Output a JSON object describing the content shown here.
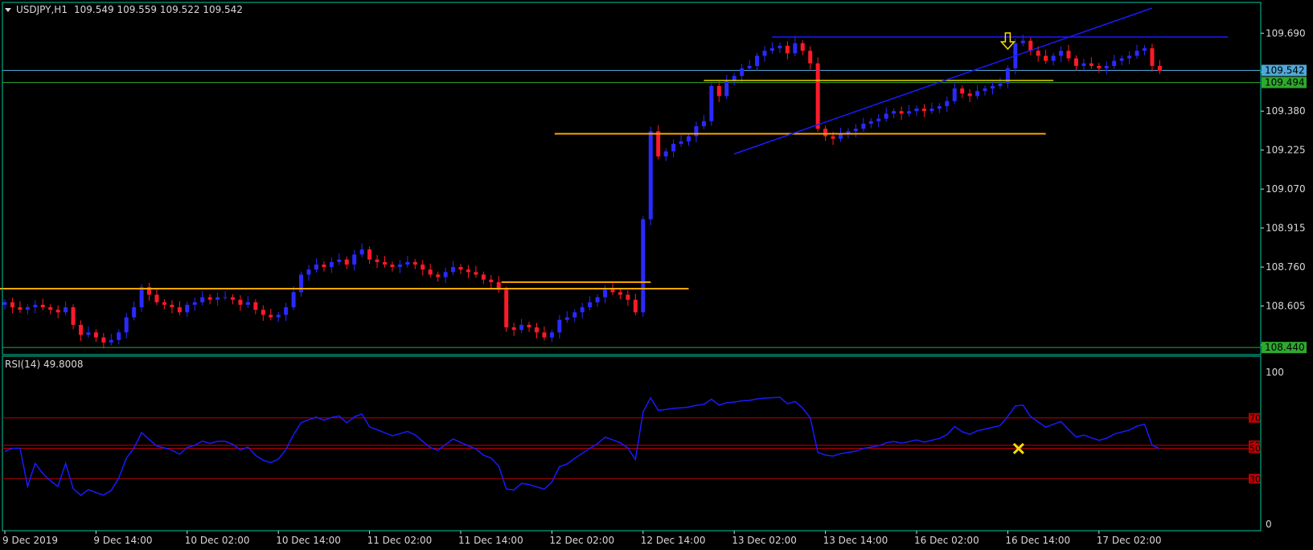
{
  "header": {
    "symbol": "USDJPY,H1",
    "ohlc": "109.549 109.559 109.522 109.542",
    "rsi_label": "RSI(14) 49.8008"
  },
  "colors": {
    "background": "#000000",
    "frame": "#00c8a0",
    "text": "#d8d8d8",
    "bull": "#2a2aff",
    "bear": "#ff1a2a",
    "level": "#ffa500",
    "support": "#e0d000",
    "trend": "#1a1aff",
    "current_price": "#4fa8d8",
    "band": "#2ea82e",
    "rsi": "#1a1aff",
    "rsi_level": "#c00000",
    "signal": "#ffe000"
  },
  "chart_data": [
    {
      "type": "candlestick",
      "title": "USDJPY,H1",
      "ylim": [
        108.415,
        109.79
      ],
      "y_ticks": [
        109.69,
        109.535,
        109.38,
        109.225,
        109.07,
        108.915,
        108.76,
        108.605,
        108.45
      ],
      "y_tick_labels": [
        "109.690",
        "",
        "109.380",
        "109.225",
        "109.070",
        "108.915",
        "108.760",
        "108.605",
        ""
      ],
      "x_labels": [
        {
          "bar": 0,
          "label": "9 Dec 2019"
        },
        {
          "bar": 12,
          "label": "9 Dec 14:00"
        },
        {
          "bar": 24,
          "label": "10 Dec 02:00"
        },
        {
          "bar": 36,
          "label": "10 Dec 14:00"
        },
        {
          "bar": 48,
          "label": "11 Dec 02:00"
        },
        {
          "bar": 60,
          "label": "11 Dec 14:00"
        },
        {
          "bar": 72,
          "label": "12 Dec 02:00"
        },
        {
          "bar": 84,
          "label": "12 Dec 14:00"
        },
        {
          "bar": 96,
          "label": "13 Dec 02:00"
        },
        {
          "bar": 108,
          "label": "13 Dec 14:00"
        },
        {
          "bar": 120,
          "label": "16 Dec 02:00"
        },
        {
          "bar": 132,
          "label": "16 Dec 14:00"
        },
        {
          "bar": 144,
          "label": "17 Dec 02:00"
        }
      ],
      "close": [
        108.62,
        108.6,
        108.59,
        108.6,
        108.61,
        108.6,
        108.59,
        108.58,
        108.6,
        108.53,
        108.49,
        108.5,
        108.48,
        108.46,
        108.47,
        108.5,
        108.56,
        108.6,
        108.68,
        108.65,
        108.62,
        108.61,
        108.6,
        108.58,
        108.61,
        108.62,
        108.64,
        108.63,
        108.64,
        108.64,
        108.63,
        108.61,
        108.62,
        108.59,
        108.57,
        108.56,
        108.57,
        108.6,
        108.66,
        108.73,
        108.75,
        108.77,
        108.76,
        108.78,
        108.79,
        108.77,
        108.81,
        108.83,
        108.79,
        108.78,
        108.77,
        108.76,
        108.77,
        108.78,
        108.77,
        108.75,
        108.73,
        108.72,
        108.74,
        108.76,
        108.75,
        108.74,
        108.73,
        108.71,
        108.7,
        108.67,
        108.52,
        108.51,
        108.53,
        108.52,
        108.5,
        108.48,
        108.5,
        108.55,
        108.56,
        108.58,
        108.6,
        108.62,
        108.64,
        108.67,
        108.66,
        108.65,
        108.63,
        108.58,
        108.95,
        109.3,
        109.2,
        109.22,
        109.25,
        109.26,
        109.28,
        109.32,
        109.34,
        109.48,
        109.44,
        109.5,
        109.52,
        109.55,
        109.56,
        109.6,
        109.62,
        109.63,
        109.64,
        109.61,
        109.65,
        109.62,
        109.57,
        109.31,
        109.28,
        109.27,
        109.29,
        109.3,
        109.31,
        109.33,
        109.34,
        109.35,
        109.37,
        109.38,
        109.37,
        109.38,
        109.39,
        109.38,
        109.39,
        109.4,
        109.42,
        109.47,
        109.45,
        109.44,
        109.46,
        109.47,
        109.48,
        109.49,
        109.55,
        109.65,
        109.66,
        109.62,
        109.6,
        109.58,
        109.6,
        109.62,
        109.59,
        109.56,
        109.57,
        109.56,
        109.55,
        109.56,
        109.58,
        109.59,
        109.6,
        109.62,
        109.63,
        109.56,
        109.54
      ],
      "rsi": {
        "label": "RSI(14) 49.8008",
        "ylim": [
          0,
          100
        ],
        "levels": [
          70,
          52,
          50,
          30
        ],
        "level_labels": [
          "70",
          "52",
          "50",
          "30"
        ],
        "top_label": "100",
        "bottom_label": "0",
        "current": 49.8008
      },
      "annotations": {
        "current_price": 109.542,
        "current_price_label": "109.542",
        "band_high": 109.494,
        "band_high_label": "109.494",
        "band_low": 108.44,
        "band_low_label": "108.440",
        "resistance": [
          {
            "from_bar": 0,
            "to_bar": 90,
            "price": 108.674
          },
          {
            "from_bar": 66,
            "to_bar": 85,
            "price": 108.7
          },
          {
            "from_bar": 73,
            "to_bar": 137,
            "price": 109.29
          }
        ],
        "support_line": {
          "from_bar": 92,
          "to_bar": 138,
          "price": 109.502
        },
        "top_line": {
          "from_bar": 101,
          "to_bar": 161,
          "price": 109.675
        },
        "trendline": {
          "from_bar": 96,
          "from_price": 109.21,
          "to_bar": 151,
          "to_price": 109.79
        },
        "down_arrow_bar": 132,
        "rsi_signal_bar": 133
      }
    }
  ]
}
